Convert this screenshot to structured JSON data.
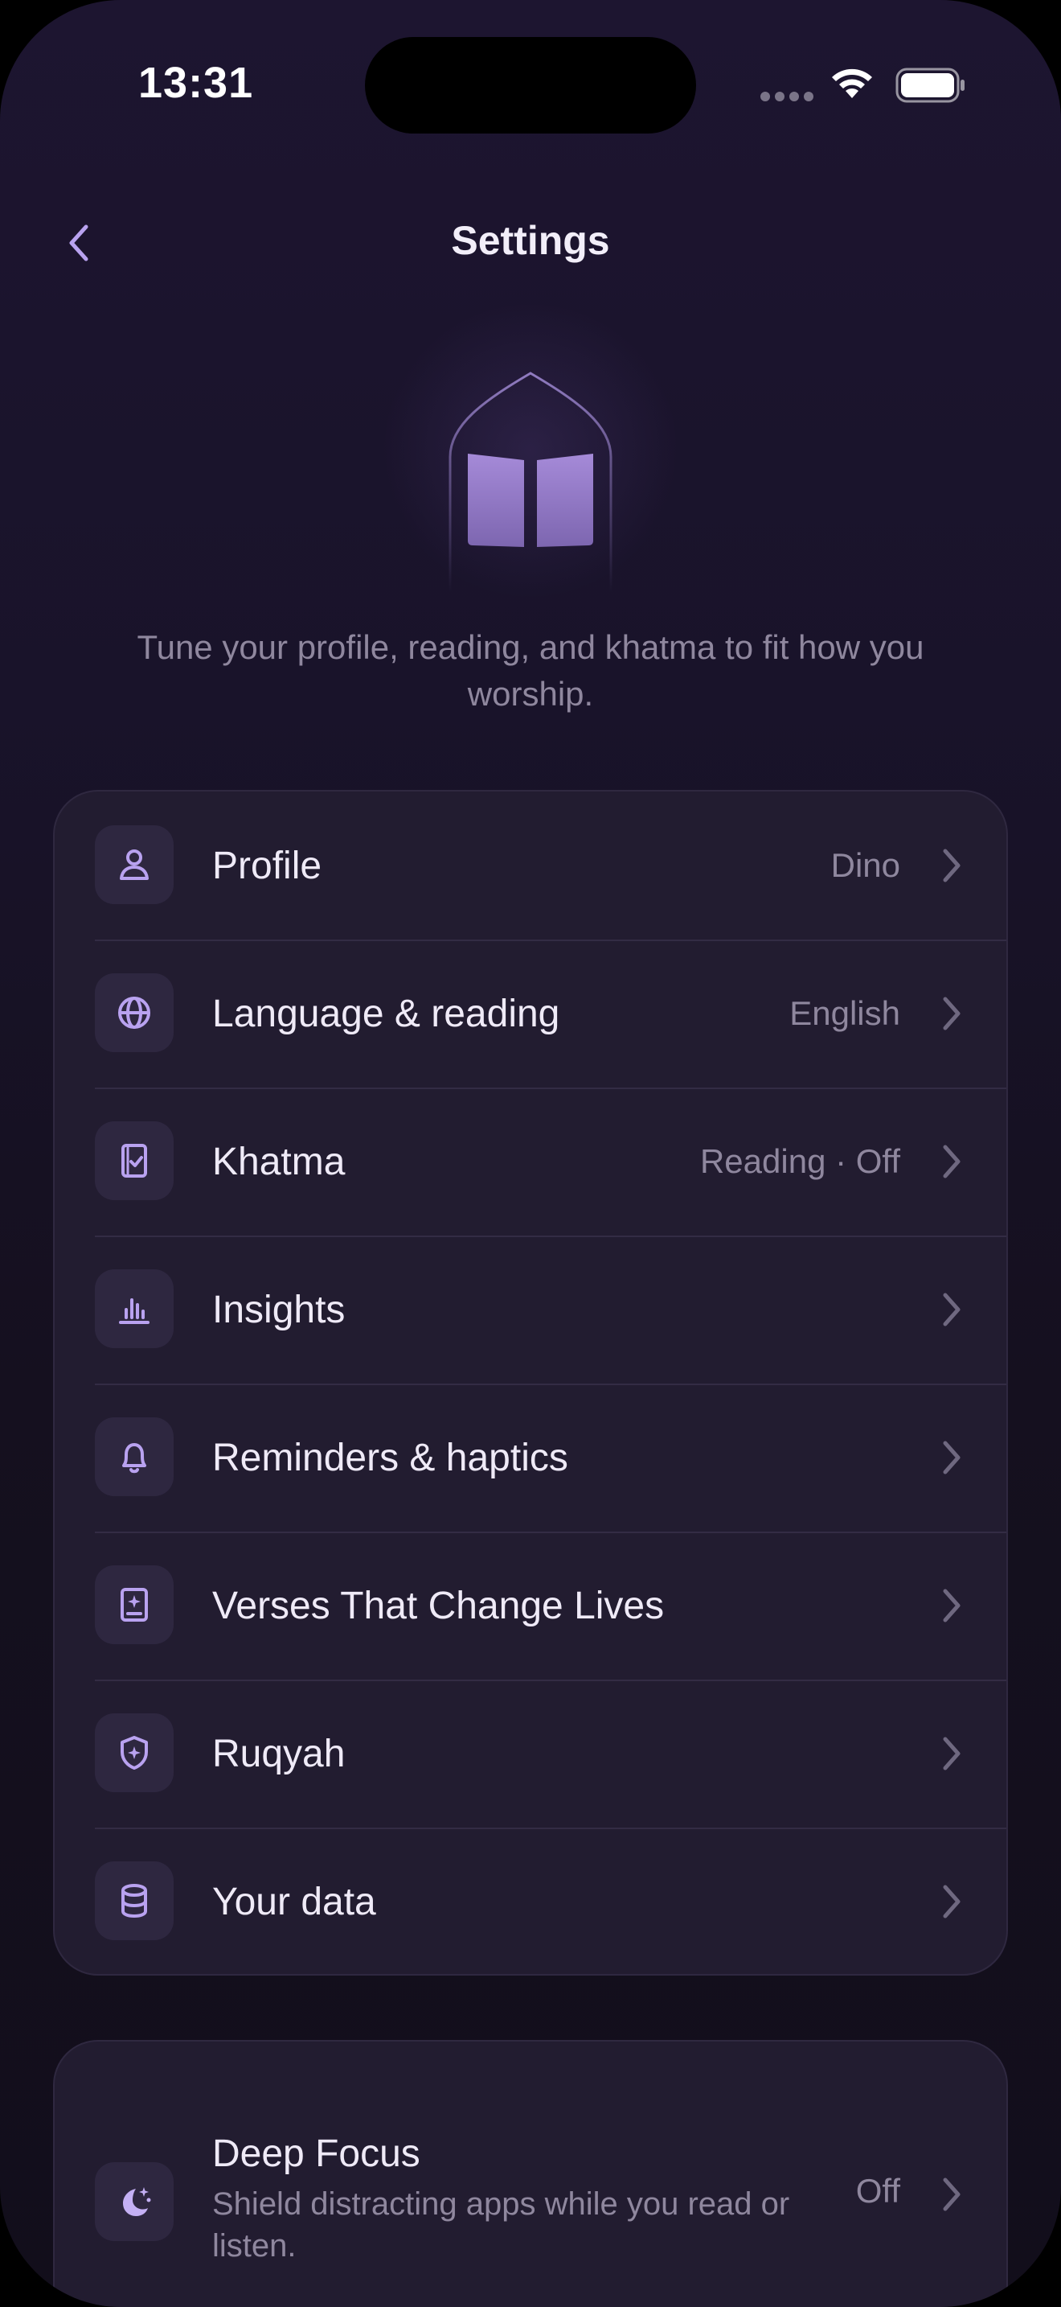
{
  "status_bar": {
    "time": "13:31"
  },
  "nav": {
    "title": "Settings",
    "back_icon": "chevron-left-icon"
  },
  "hero": {
    "icon": "open-book-arch-icon",
    "subtitle": "Tune your profile, reading, and khatma to fit how you worship."
  },
  "settings": [
    {
      "label": "Profile",
      "value": "Dino",
      "icon": "person-icon"
    },
    {
      "label": "Language & reading",
      "value": "English",
      "icon": "globe-icon"
    },
    {
      "label": "Khatma",
      "value": "Reading · Off",
      "icon": "book-check-icon"
    },
    {
      "label": "Insights",
      "value": "",
      "icon": "bar-chart-icon"
    },
    {
      "label": "Reminders & haptics",
      "value": "",
      "icon": "bell-icon"
    },
    {
      "label": "Verses That Change Lives",
      "value": "",
      "icon": "sparkle-page-icon"
    },
    {
      "label": "Ruqyah",
      "value": "",
      "icon": "shield-icon"
    },
    {
      "label": "Your data",
      "value": "",
      "icon": "database-icon"
    }
  ],
  "deep_focus": {
    "title": "Deep Focus",
    "description": "Shield distracting apps while you read or listen.",
    "value": "Off",
    "icon": "moon-stars-icon"
  },
  "colors": {
    "accent": "#b9a2f0",
    "background": "#19132a",
    "card": "#221c30",
    "text_primary": "#efeaf7",
    "text_secondary": "#8f879e"
  }
}
